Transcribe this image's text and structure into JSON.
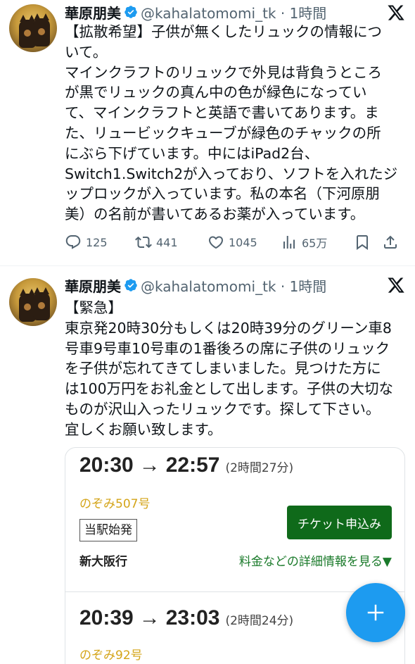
{
  "tweets": [
    {
      "author_name": "華原朋美",
      "handle_time": "@kahalatomomi_tk · 1時間",
      "lines": [
        "【拡散希望】子供が無くしたリュックの情報につ",
        "いて。",
        "マインクラフトのリュックで外見は背負うところ",
        "が黒でリュックの真ん中の色が緑色になってい",
        "て、マインクラフトと英語で書いてあります。ま",
        "た、リュービックキューブが緑色のチャックの所",
        "にぶら下げています。中にはiPad2台、",
        "Switch1.Switch2が入っており、ソフトを入れたジ",
        "ップロックが入っています。私の本名（下河原朋",
        "美）の名前が書いてあるお薬が入っています。"
      ],
      "replies": "125",
      "reposts": "441",
      "likes": "1045",
      "views": "65万"
    },
    {
      "author_name": "華原朋美",
      "handle_time": "@kahalatomomi_tk · 1時間",
      "lines": [
        "【緊急】",
        "東京発20時30分もしくは20時39分のグリーン車8",
        "号車9号車10号車の1番後ろの席に子供のリュック",
        "を子供が忘れてきてしまいました。見つけた方に",
        "は100万円をお礼金として出します。子供の大切な",
        "ものが沢山入ったリュックです。探して下さい。",
        "宜しくお願い致します。"
      ],
      "card": {
        "depart1": "20:30",
        "arrive1": "22:57",
        "duration1": "(2時間27分)",
        "train1": "のぞみ507号",
        "origin_badge": "当駅始発",
        "ticket_button": "チケット申込み",
        "destination": "新大阪行",
        "details_link": "料金などの詳細情報を見る▼",
        "depart2": "20:39",
        "arrive2": "23:03",
        "duration2": "(2時間24分)",
        "train2": "のぞみ92号"
      }
    }
  ],
  "arrow": "→",
  "colors": {
    "verified": "#1d9bf0",
    "fab": "#1d9bf0",
    "ticket_button": "#0f6a1a",
    "train_name": "#d4a418",
    "link": "#1a7a2a"
  }
}
